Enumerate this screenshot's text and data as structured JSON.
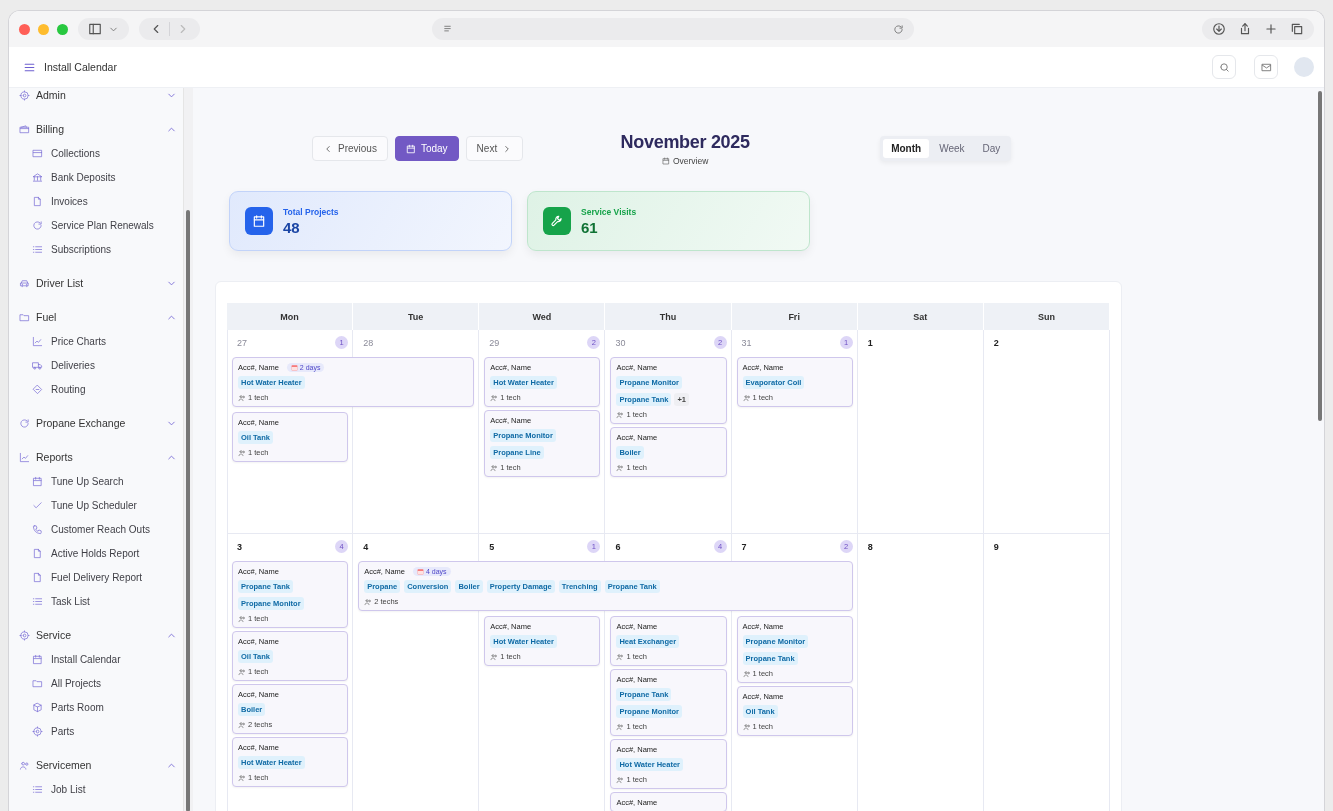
{
  "header": {
    "title": "Install Calendar"
  },
  "sidebar": {
    "sections": [
      {
        "label": "Admin",
        "expanded": false
      },
      {
        "label": "Billing",
        "expanded": true,
        "items": [
          {
            "label": "Collections"
          },
          {
            "label": "Bank Deposits"
          },
          {
            "label": "Invoices"
          },
          {
            "label": "Service Plan Renewals"
          },
          {
            "label": "Subscriptions"
          }
        ]
      },
      {
        "label": "Driver List",
        "expanded": false
      },
      {
        "label": "Fuel",
        "expanded": true,
        "items": [
          {
            "label": "Price Charts"
          },
          {
            "label": "Deliveries"
          },
          {
            "label": "Routing"
          }
        ]
      },
      {
        "label": "Propane Exchange",
        "expanded": false
      },
      {
        "label": "Reports",
        "expanded": true,
        "items": [
          {
            "label": "Tune Up Search"
          },
          {
            "label": "Tune Up Scheduler"
          },
          {
            "label": "Customer Reach Outs"
          },
          {
            "label": "Active Holds Report"
          },
          {
            "label": "Fuel Delivery Report"
          },
          {
            "label": "Task List"
          }
        ]
      },
      {
        "label": "Service",
        "expanded": true,
        "items": [
          {
            "label": "Install Calendar"
          },
          {
            "label": "All Projects"
          },
          {
            "label": "Parts Room"
          },
          {
            "label": "Parts"
          }
        ]
      },
      {
        "label": "Servicemen",
        "expanded": true,
        "items": [
          {
            "label": "Job List"
          }
        ]
      }
    ]
  },
  "toolbar": {
    "buttons": [
      {
        "label": "Previous",
        "kind": "prev"
      },
      {
        "label": "Today",
        "kind": "today"
      },
      {
        "label": "Next",
        "kind": "next"
      }
    ],
    "title": "November 2025",
    "subtitle": "Overview",
    "views": [
      {
        "label": "Month",
        "selected": true
      },
      {
        "label": "Week",
        "selected": false
      },
      {
        "label": "Day",
        "selected": false
      }
    ]
  },
  "stats": [
    {
      "label": "Total Projects",
      "value": "48",
      "color": "#2563eb"
    },
    {
      "label": "Service Visits",
      "value": "61",
      "color": "#16a34a"
    }
  ],
  "calendar": {
    "weekdays": [
      "Mon",
      "Tue",
      "Wed",
      "Thu",
      "Fri",
      "Sat",
      "Sun"
    ],
    "weeks": [
      {
        "days": [
          {
            "number": "27",
            "muted": true,
            "count": "1",
            "events": [
              {
                "kind": "multi",
                "title": "Acc#, Name",
                "duration": "2 days",
                "tags": [
                  "Hot Water Heater"
                ],
                "techs": "1 tech"
              },
              {
                "kind": "single",
                "title": "Acc#, Name",
                "tags": [
                  "Oil Tank"
                ],
                "techs": "1 tech"
              }
            ]
          },
          {
            "number": "28",
            "muted": true,
            "events": [
              {
                "kind": "continuation"
              }
            ]
          },
          {
            "number": "29",
            "muted": true,
            "count": "2",
            "events": [
              {
                "kind": "single",
                "title": "Acc#, Name",
                "tags": [
                  "Hot Water Heater"
                ],
                "techs": "1 tech"
              },
              {
                "kind": "single",
                "title": "Acc#, Name",
                "tags": [
                  "Propane Monitor",
                  "Propane Line"
                ],
                "techs": "1 tech"
              }
            ]
          },
          {
            "number": "30",
            "muted": true,
            "count": "2",
            "events": [
              {
                "kind": "single",
                "title": "Acc#, Name",
                "tags": [
                  "Propane Monitor",
                  "Propane Tank"
                ],
                "more": "+1",
                "techs": "1 tech"
              },
              {
                "kind": "single",
                "title": "Acc#, Name",
                "tags": [
                  "Boiler"
                ],
                "techs": "1 tech"
              }
            ]
          },
          {
            "number": "31",
            "muted": true,
            "count": "1",
            "events": [
              {
                "kind": "single",
                "title": "Acc#, Name",
                "tags": [
                  "Evaporator Coil"
                ],
                "techs": "1 tech"
              }
            ]
          },
          {
            "number": "1",
            "muted": false
          },
          {
            "number": "2",
            "muted": false
          }
        ]
      },
      {
        "days": [
          {
            "number": "3",
            "muted": false,
            "count": "4",
            "events": [
              {
                "kind": "single",
                "title": "Acc#, Name",
                "tags": [
                  "Propane Tank",
                  "Propane Monitor"
                ],
                "techs": "1 tech"
              },
              {
                "kind": "single",
                "title": "Acc#, Name",
                "tags": [
                  "Oil Tank"
                ],
                "techs": "1 tech"
              },
              {
                "kind": "single",
                "title": "Acc#, Name",
                "tags": [
                  "Boiler"
                ],
                "techs": "2 techs"
              },
              {
                "kind": "single",
                "title": "Acc#, Name",
                "tags": [
                  "Hot Water Heater"
                ],
                "techs": "1 tech"
              }
            ]
          },
          {
            "number": "4",
            "muted": false,
            "events": [
              {
                "kind": "multi",
                "title": "Acc#, Name",
                "duration": "4 days",
                "tags": [
                  "Propane",
                  "Conversion",
                  "Boiler",
                  "Property Damage",
                  "Trenching",
                  "Propane Tank"
                ],
                "techs": "2 techs"
              }
            ]
          },
          {
            "number": "5",
            "muted": false,
            "count": "1",
            "events": [
              {
                "kind": "continuation"
              },
              {
                "kind": "single",
                "title": "Acc#, Name",
                "tags": [
                  "Hot Water Heater"
                ],
                "techs": "1 tech"
              }
            ]
          },
          {
            "number": "6",
            "muted": false,
            "count": "4",
            "events": [
              {
                "kind": "continuation"
              },
              {
                "kind": "single",
                "title": "Acc#, Name",
                "tags": [
                  "Heat Exchanger"
                ],
                "techs": "1 tech"
              },
              {
                "kind": "single",
                "title": "Acc#, Name",
                "tags": [
                  "Propane Tank",
                  "Propane Monitor"
                ],
                "techs": "1 tech"
              },
              {
                "kind": "single",
                "title": "Acc#, Name",
                "tags": [
                  "Hot Water Heater"
                ],
                "techs": "1 tech"
              },
              {
                "kind": "single",
                "title": "Acc#, Name"
              }
            ]
          },
          {
            "number": "7",
            "muted": false,
            "count": "2",
            "events": [
              {
                "kind": "continuation"
              },
              {
                "kind": "single",
                "title": "Acc#, Name",
                "tags": [
                  "Propane Monitor",
                  "Propane Tank"
                ],
                "techs": "1 tech"
              },
              {
                "kind": "single",
                "title": "Acc#, Name",
                "tags": [
                  "Oil Tank"
                ],
                "techs": "1 tech"
              }
            ]
          },
          {
            "number": "8",
            "muted": false
          },
          {
            "number": "9",
            "muted": false
          }
        ]
      }
    ]
  }
}
